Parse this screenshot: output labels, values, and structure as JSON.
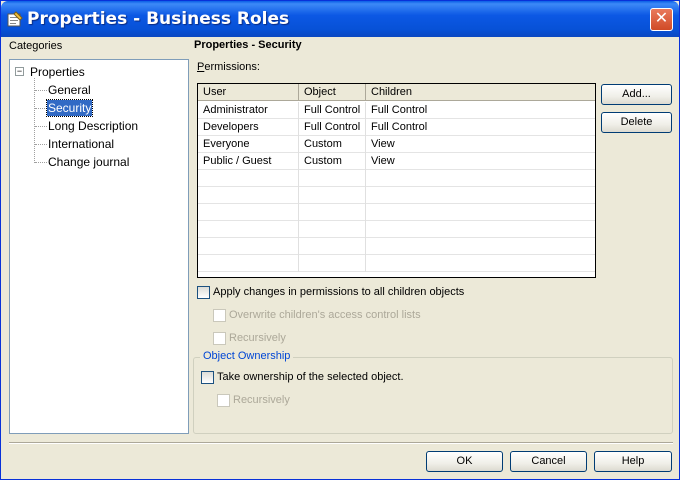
{
  "window": {
    "title": "Properties - Business Roles",
    "close_label": "✕"
  },
  "categories": {
    "label": "Categories",
    "expander": "−",
    "root": "Properties",
    "items": [
      "General",
      "Security",
      "Long Description",
      "International",
      "Change journal"
    ],
    "selected": "Security"
  },
  "security": {
    "heading": "Properties - Security",
    "permissions_label": "Permissions:",
    "permissions_accel": "P",
    "columns": [
      "User",
      "Object",
      "Children"
    ],
    "rows": [
      {
        "user": "Administrator",
        "object": "Full Control",
        "children": "Full Control"
      },
      {
        "user": "Developers",
        "object": "Full Control",
        "children": "Full Control"
      },
      {
        "user": "Everyone",
        "object": "Custom",
        "children": "View"
      },
      {
        "user": "Public / Guest",
        "object": "Custom",
        "children": "View"
      }
    ],
    "add_label": "Add...",
    "delete_label": "Delete",
    "apply_children": "Apply changes in permissions to all children objects",
    "overwrite_acl": "Overwrite children's access control lists",
    "recursively_1": "Recursively"
  },
  "ownership": {
    "group_title": "Object Ownership",
    "take_ownership": "Take ownership of the selected object.",
    "recursively": "Recursively"
  },
  "footer": {
    "ok": "OK",
    "cancel": "Cancel",
    "help": "Help"
  }
}
